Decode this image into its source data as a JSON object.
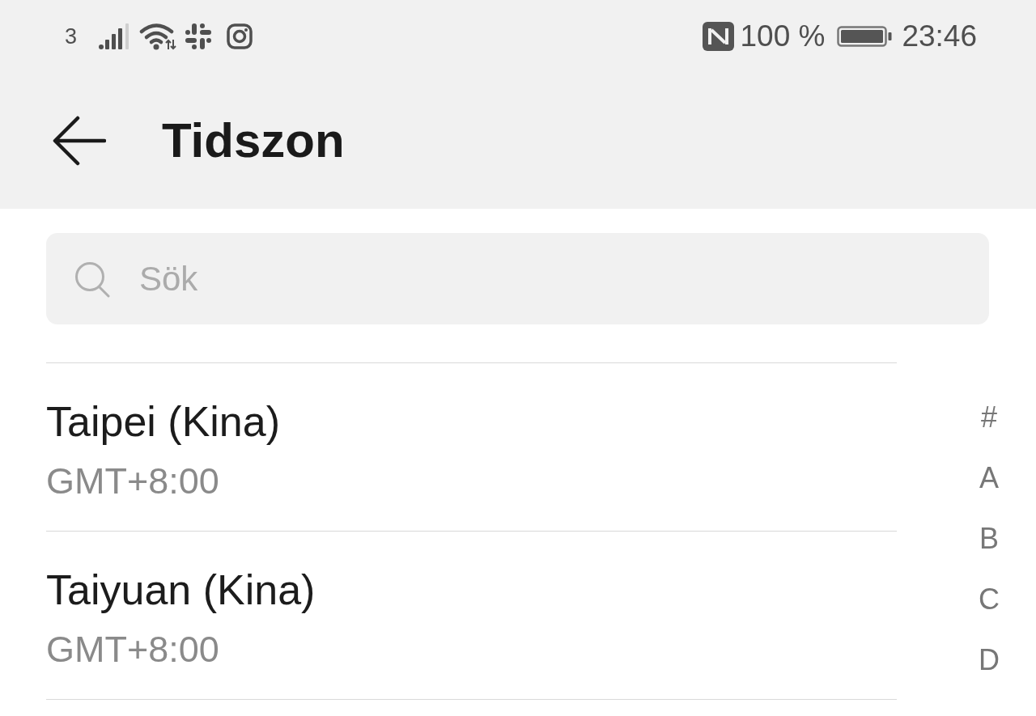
{
  "status_bar": {
    "carrier": "3",
    "battery_percent": "100 %",
    "time": "23:46"
  },
  "app_bar": {
    "title": "Tidszon"
  },
  "search": {
    "placeholder": "Sök"
  },
  "timezones": [
    {
      "name": "Taipei (Kina)",
      "offset": "GMT+8:00"
    },
    {
      "name": "Taiyuan (Kina)",
      "offset": "GMT+8:00"
    }
  ],
  "index_letters": [
    "#",
    "A",
    "B",
    "C",
    "D"
  ]
}
